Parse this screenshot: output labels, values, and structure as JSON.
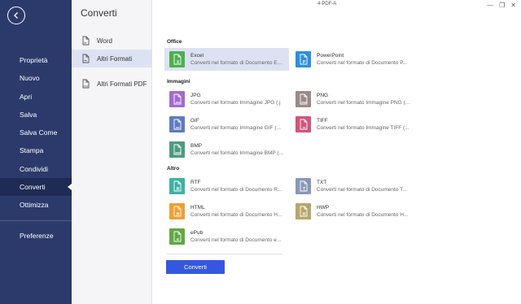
{
  "window": {
    "title": "4-PDF-A"
  },
  "nav": {
    "items": [
      {
        "label": "Proprietà",
        "name": "nav-item-proprieta"
      },
      {
        "label": "Nuovo",
        "name": "nav-item-nuovo"
      },
      {
        "label": "Apri",
        "name": "nav-item-apri"
      },
      {
        "label": "Salva",
        "name": "nav-item-salva"
      },
      {
        "label": "Salva Come",
        "name": "nav-item-salva-come"
      },
      {
        "label": "Stampa",
        "name": "nav-item-stampa"
      },
      {
        "label": "Condividi",
        "name": "nav-item-condividi"
      },
      {
        "label": "Converti",
        "name": "nav-item-converti"
      },
      {
        "label": "Ottimizza",
        "name": "nav-item-ottimizza"
      }
    ],
    "footer": {
      "label": "Preferenze"
    },
    "active_index": 7
  },
  "subnav": {
    "title": "Converti",
    "items": [
      {
        "label": "Word"
      },
      {
        "label": "Altri Formati"
      },
      {
        "label": "Altri Formati PDF"
      }
    ],
    "active_index": 1
  },
  "sections": {
    "office": {
      "title": "Office",
      "items": [
        {
          "name": "Excel",
          "desc": "Converti nel formato di Documento E...",
          "color": "#4caf50",
          "letter": "X",
          "selected": true
        },
        {
          "name": "PowerPoint",
          "desc": "Converti nel formato di Documento P...",
          "color": "#2e8fe0",
          "letter": "P"
        }
      ]
    },
    "immagini": {
      "title": "Immagini",
      "items": [
        {
          "name": "JPG",
          "desc": "Converti nel formato Immagine JPG (.j",
          "color": "#a46ad0",
          "letter": "JPG"
        },
        {
          "name": "PNG",
          "desc": "Converti nel formato Immagine PNG (...",
          "color": "#9c8a86",
          "letter": "PNG"
        },
        {
          "name": "GIF",
          "desc": "Converti nel formato Immagine GIF (...",
          "color": "#5f7bc0",
          "letter": "GIF"
        },
        {
          "name": "TIFF",
          "desc": "Converti nel formato Immagine TIFF (...",
          "color": "#d1557a",
          "letter": "TIF"
        },
        {
          "name": "BMP",
          "desc": "Converti nel formato Immagine BMP (...",
          "color": "#4f9a80",
          "letter": "BMP"
        }
      ]
    },
    "altro": {
      "title": "Altro",
      "items": [
        {
          "name": "RTF",
          "desc": "Converti nel formato di Documento R...",
          "color": "#3fb1a3",
          "letter": "R"
        },
        {
          "name": "TXT",
          "desc": "Converti nel formato di Documento T...",
          "color": "#8a97b6",
          "letter": "T"
        },
        {
          "name": "HTML",
          "desc": "Converti nel formato di Documento H...",
          "color": "#f0a030",
          "letter": "H"
        },
        {
          "name": "HWP",
          "desc": "Converti nel formato di Documento H...",
          "color": "#b5a76a",
          "letter": "H"
        },
        {
          "name": "ePub",
          "desc": "Converti nel formato di Documento e...",
          "color": "#62a844",
          "letter": "e"
        }
      ]
    }
  },
  "actions": {
    "convert_label": "Converti"
  }
}
